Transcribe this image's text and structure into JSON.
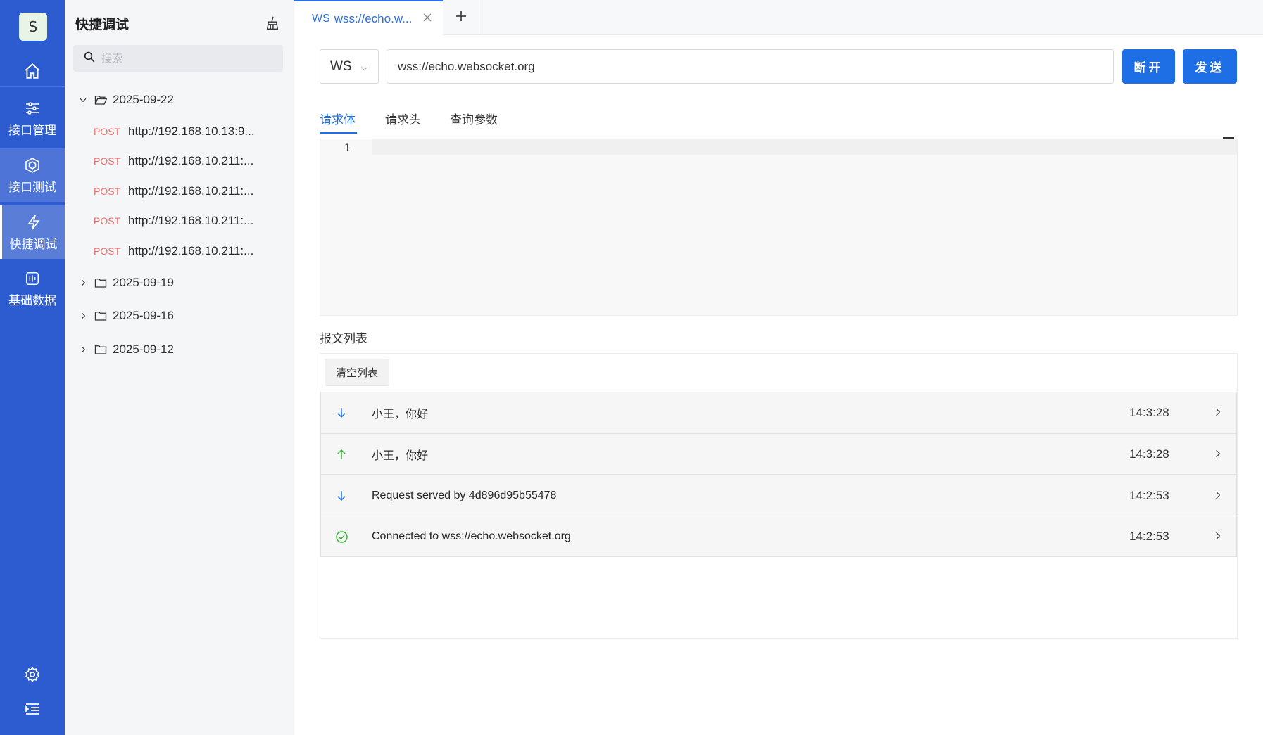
{
  "rail": {
    "avatar_letter": "S",
    "items": [
      {
        "label": "接口管理",
        "icon": "sliders-icon"
      },
      {
        "label": "接口测试",
        "icon": "cube-icon"
      },
      {
        "label": "快捷调试",
        "icon": "bolt-icon"
      },
      {
        "label": "基础数据",
        "icon": "chart-box-icon"
      }
    ],
    "active_label": "快捷调试",
    "accent": "#2d5bd0"
  },
  "panel": {
    "title": "快捷调试",
    "search_placeholder": "搜索",
    "folders": [
      {
        "date": "2025-09-22",
        "expanded": true,
        "requests": [
          {
            "method": "POST",
            "url": "http://192.168.10.13:9..."
          },
          {
            "method": "POST",
            "url": "http://192.168.10.211:..."
          },
          {
            "method": "POST",
            "url": "http://192.168.10.211:..."
          },
          {
            "method": "POST",
            "url": "http://192.168.10.211:..."
          },
          {
            "method": "POST",
            "url": "http://192.168.10.211:..."
          }
        ]
      },
      {
        "date": "2025-09-19",
        "expanded": false
      },
      {
        "date": "2025-09-16",
        "expanded": false
      },
      {
        "date": "2025-09-12",
        "expanded": false
      }
    ]
  },
  "tabs": [
    {
      "protocol": "WS",
      "name": "wss://echo.w...",
      "active": true
    }
  ],
  "request": {
    "protocol": "WS",
    "url": "wss://echo.websocket.org",
    "disconnect_label": "断开",
    "send_label": "发送",
    "primary_color": "#1e6fe6"
  },
  "subtabs": {
    "body": "请求体",
    "headers": "请求头",
    "query": "查询参数",
    "active": "请求体"
  },
  "editor": {
    "line_numbers": [
      "1"
    ],
    "content": ""
  },
  "messages": {
    "title": "报文列表",
    "clear_label": "清空列表",
    "rows": [
      {
        "direction": "received",
        "icon": "arrow-down-icon",
        "text": "小王，你好",
        "time": "14:3:28"
      },
      {
        "direction": "sent",
        "icon": "arrow-up-icon",
        "text": "小王，你好",
        "time": "14:3:28"
      },
      {
        "direction": "received",
        "icon": "arrow-down-icon",
        "text": "Request served by 4d896d95b55478",
        "time": "14:2:53"
      },
      {
        "direction": "status",
        "icon": "check-circle-icon",
        "text": "Connected to wss://echo.websocket.org",
        "time": "14:2:53"
      }
    ]
  }
}
